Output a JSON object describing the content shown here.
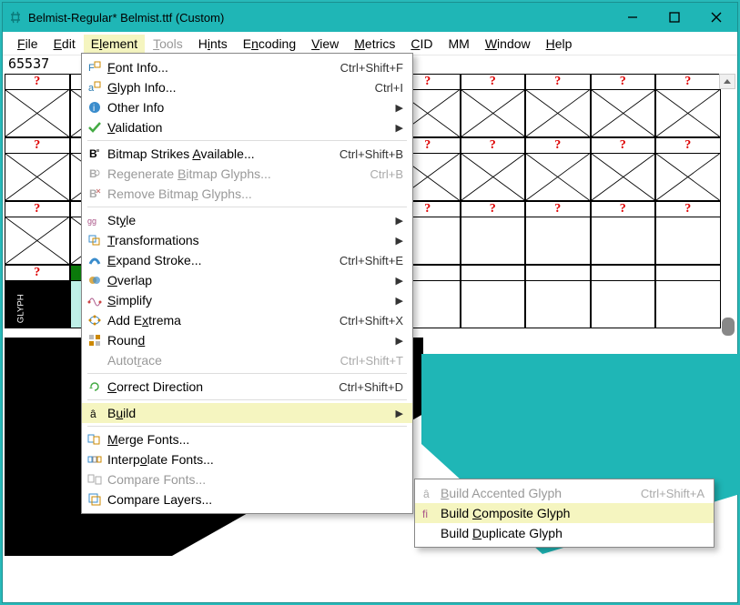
{
  "titlebar": {
    "title": "Belmist-Regular*  Belmist.ttf (Custom)"
  },
  "menubar": {
    "file": "File",
    "edit": "Edit",
    "element": "Element",
    "tools": "Tools",
    "hints": "Hints",
    "encoding": "Encoding",
    "view": "View",
    "metrics": "Metrics",
    "cid": "CID",
    "mm": "MM",
    "window": "Window",
    "help": "Help"
  },
  "counter": "65537",
  "elementMenu": {
    "fontInfo": {
      "label": "Font Info...",
      "shortcut": "Ctrl+Shift+F"
    },
    "glyphInfo": {
      "label": "Glyph Info...",
      "shortcut": "Ctrl+I"
    },
    "otherInfo": {
      "label": "Other Info"
    },
    "validation": {
      "label": "Validation"
    },
    "bitmapStrikes": {
      "label": "Bitmap Strikes Available...",
      "shortcut": "Ctrl+Shift+B"
    },
    "regenBitmap": {
      "label": "Regenerate Bitmap Glyphs...",
      "shortcut": "Ctrl+B"
    },
    "removeBitmap": {
      "label": "Remove Bitmap Glyphs..."
    },
    "style": {
      "label": "Style"
    },
    "transformations": {
      "label": "Transformations"
    },
    "expandStroke": {
      "label": "Expand Stroke...",
      "shortcut": "Ctrl+Shift+E"
    },
    "overlap": {
      "label": "Overlap"
    },
    "simplify": {
      "label": "Simplify"
    },
    "addExtrema": {
      "label": "Add Extrema",
      "shortcut": "Ctrl+Shift+X"
    },
    "round": {
      "label": "Round"
    },
    "autotrace": {
      "label": "Autotrace",
      "shortcut": "Ctrl+Shift+T"
    },
    "correctDir": {
      "label": "Correct Direction",
      "shortcut": "Ctrl+Shift+D"
    },
    "build": {
      "label": "Build"
    },
    "mergeFonts": {
      "label": "Merge Fonts..."
    },
    "interpolateFonts": {
      "label": "Interpolate Fonts..."
    },
    "compareFonts": {
      "label": "Compare Fonts..."
    },
    "compareLayers": {
      "label": "Compare Layers..."
    }
  },
  "buildSubmenu": {
    "accented": {
      "label": "Build Accented Glyph",
      "shortcut": "Ctrl+Shift+A"
    },
    "composite": {
      "label": "Build Composite Glyph"
    },
    "duplicate": {
      "label": "Build Duplicate Glyph"
    }
  },
  "glyph_q": "?"
}
